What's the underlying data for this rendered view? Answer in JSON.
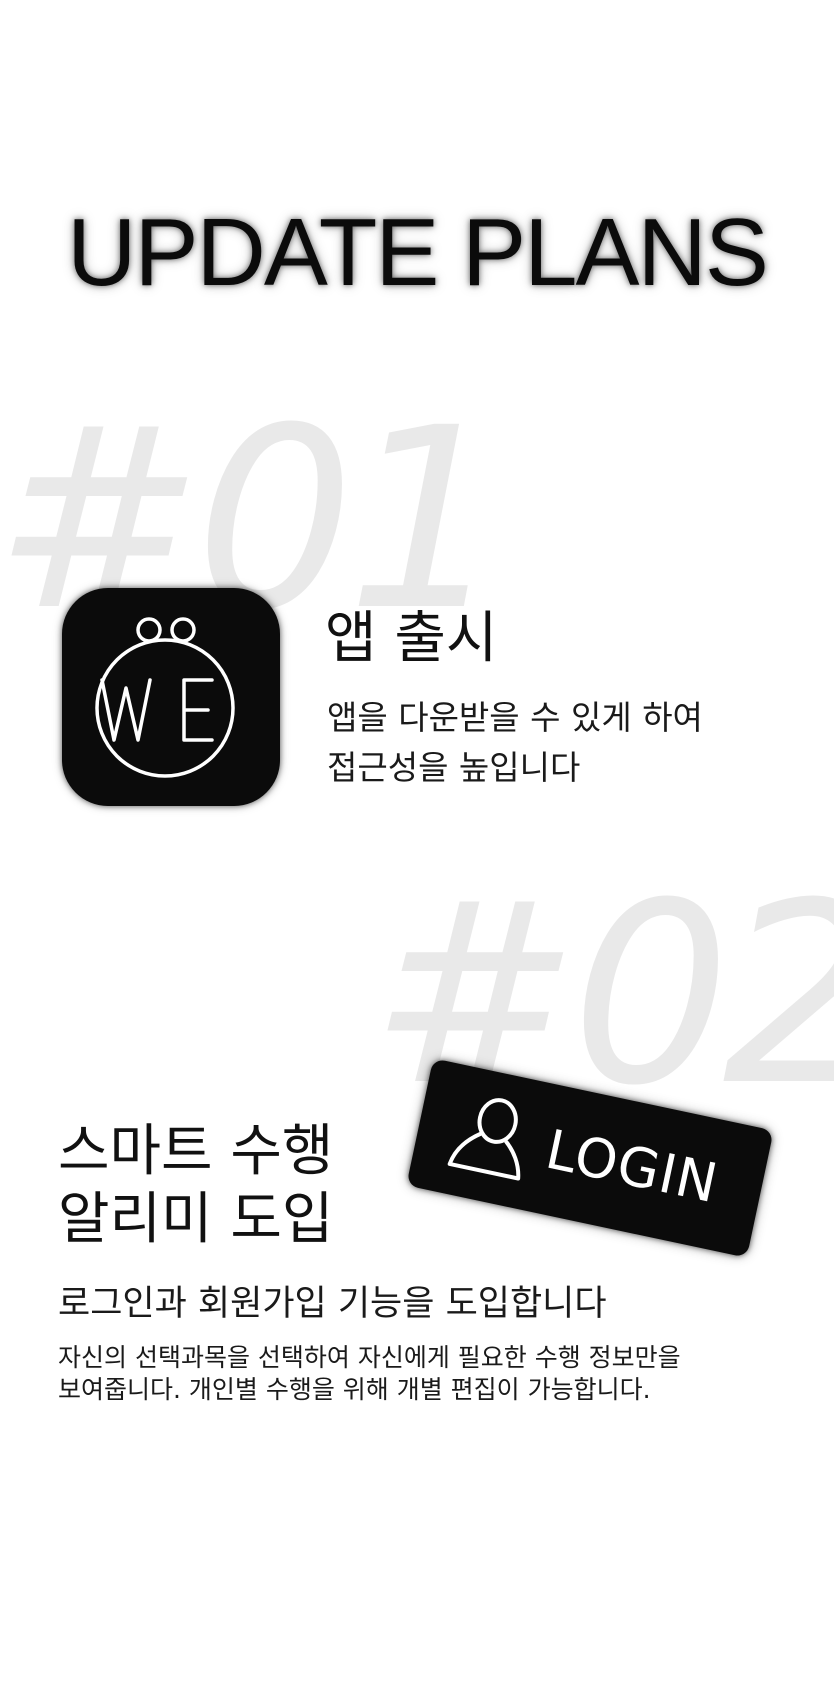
{
  "header": {
    "title": "UPDATE PLANS"
  },
  "feature1": {
    "number": "#01",
    "icon": "we-app-icon",
    "title": "앱 출시",
    "description": [
      "앱을 다운받을 수 있게 하여",
      "접근성을 높입니다"
    ]
  },
  "feature2": {
    "number": "#02",
    "title": [
      "스마트 수행",
      "알리미 도입"
    ],
    "badge": {
      "icon": "user-icon",
      "label": "LOGIN"
    },
    "subtitle": "로그인과 회원가입 기능을 도입합니다",
    "description": [
      "자신의 선택과목을 선택하여 자신에게 필요한 수행 정보만을",
      "보여줍니다. 개인별 수행을 위해 개별 편집이 가능합니다."
    ]
  },
  "colors": {
    "background": "#ffffff",
    "ink": "#0b0b0b",
    "watermark": "#e9e9e9"
  }
}
